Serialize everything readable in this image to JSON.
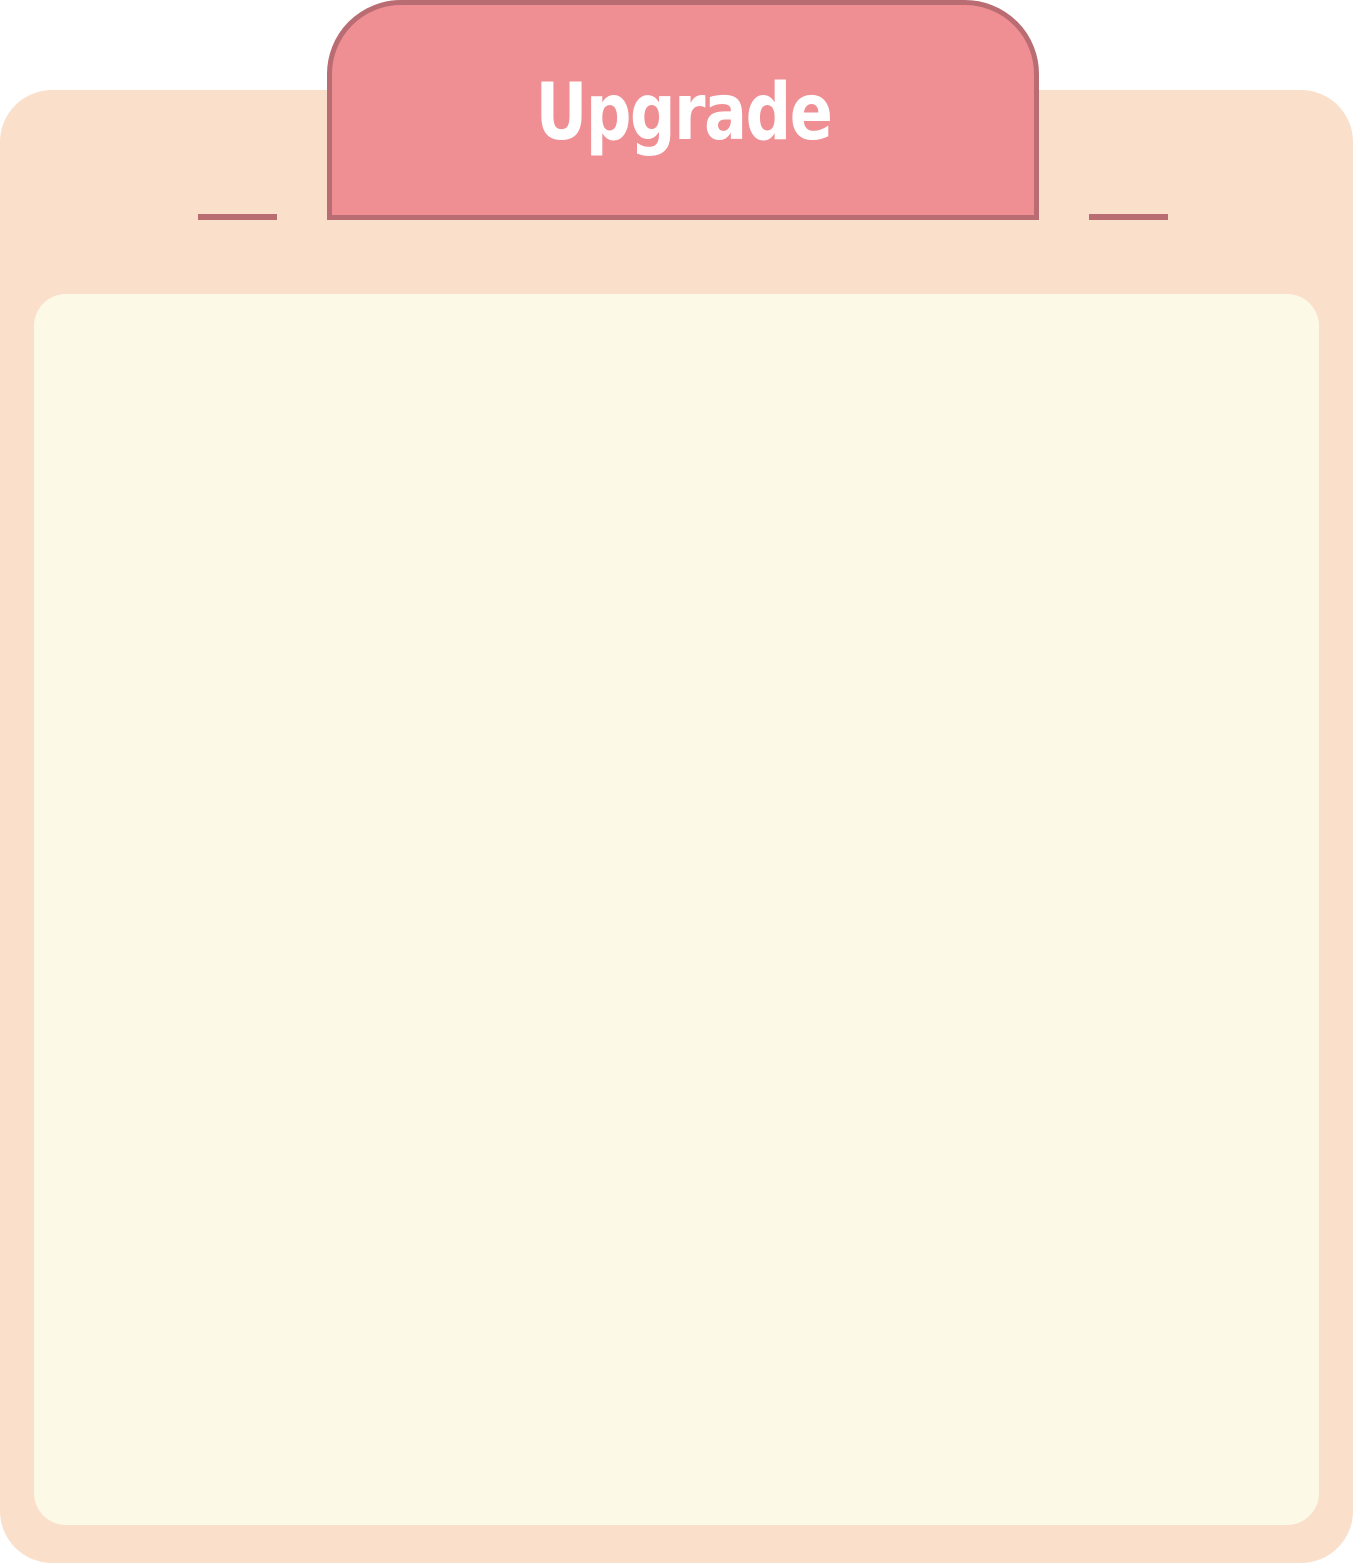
{
  "dialog": {
    "title": "Upgrade"
  },
  "colors": {
    "panel_background": "#fadfca",
    "content_background": "#fdf9e7",
    "title_tab_fill": "#ef8e93",
    "title_tab_border": "#b96c72",
    "title_text": "#ffffff"
  }
}
